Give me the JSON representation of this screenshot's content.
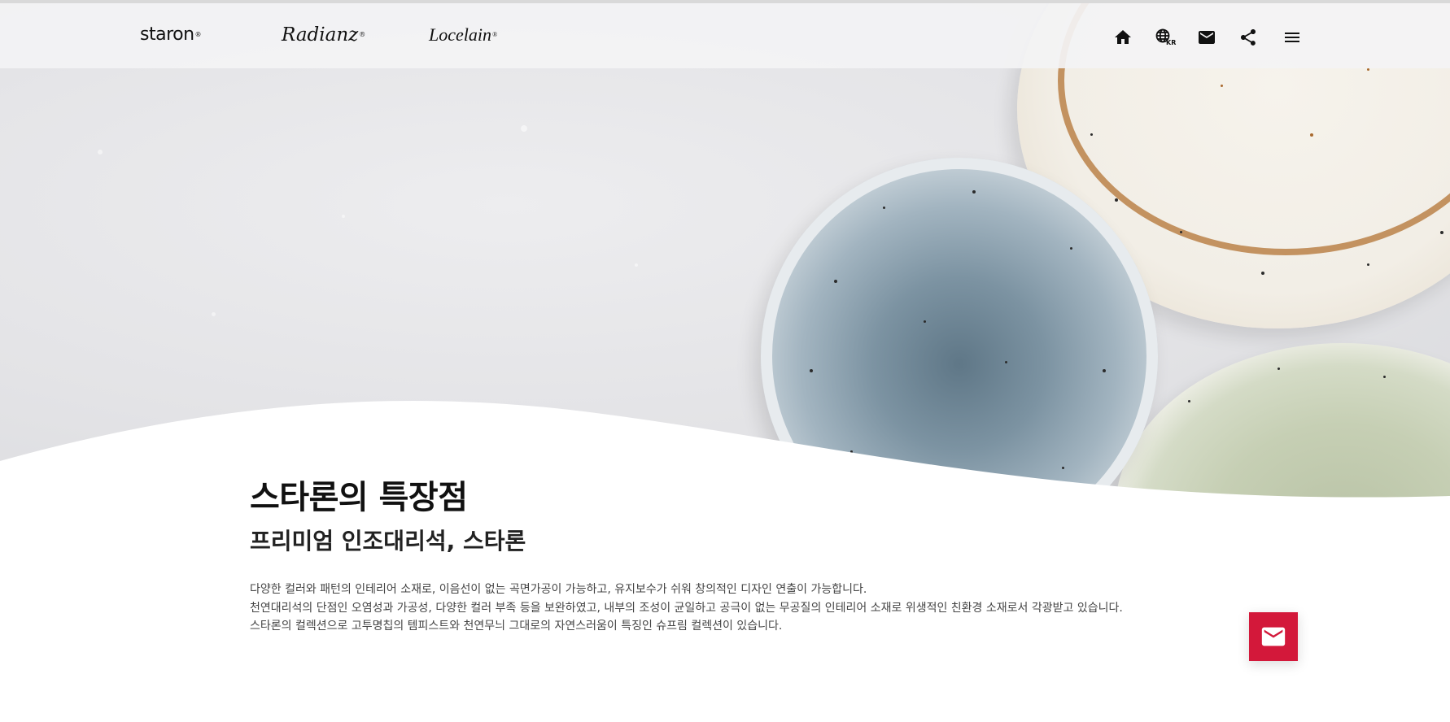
{
  "header": {
    "brands": [
      {
        "name": "staron",
        "mark": "®"
      },
      {
        "name": "Radianz",
        "mark": "®"
      },
      {
        "name": "Locelain",
        "mark": "®"
      }
    ],
    "nav_icons": [
      "home-icon",
      "globe-icon",
      "mail-icon",
      "share-icon",
      "menu-icon"
    ],
    "language_code": "KR"
  },
  "main": {
    "title": "스타론의 특장점",
    "subtitle": "프리미엄 인조대리석, 스타론",
    "description": [
      "다양한 컬러와 패턴의 인테리어 소재로, 이음선이 없는 곡면가공이 가능하고, 유지보수가 쉬워 창의적인 디자인 연출이 가능합니다.",
      "천연대리석의 단점인 오염성과 가공성, 다양한 컬러 부족 등을 보완하였고, 내부의 조성이 균일하고 공극이 없는 무공질의 인테리어 소재로 위생적인 친환경 소재로서 각광받고 있습니다.",
      "스타론의 컬렉션으로 고투명칩의 템피스트와 천연무늬 그대로의 자연스러움이 특징인 슈프림 컬렉션이 있습니다."
    ]
  },
  "floating_action": {
    "icon": "mail-icon"
  },
  "colors": {
    "accent": "#d3183a",
    "header_bg": "#f3f3f4",
    "text_dark": "#111111",
    "text_body": "#444444"
  }
}
